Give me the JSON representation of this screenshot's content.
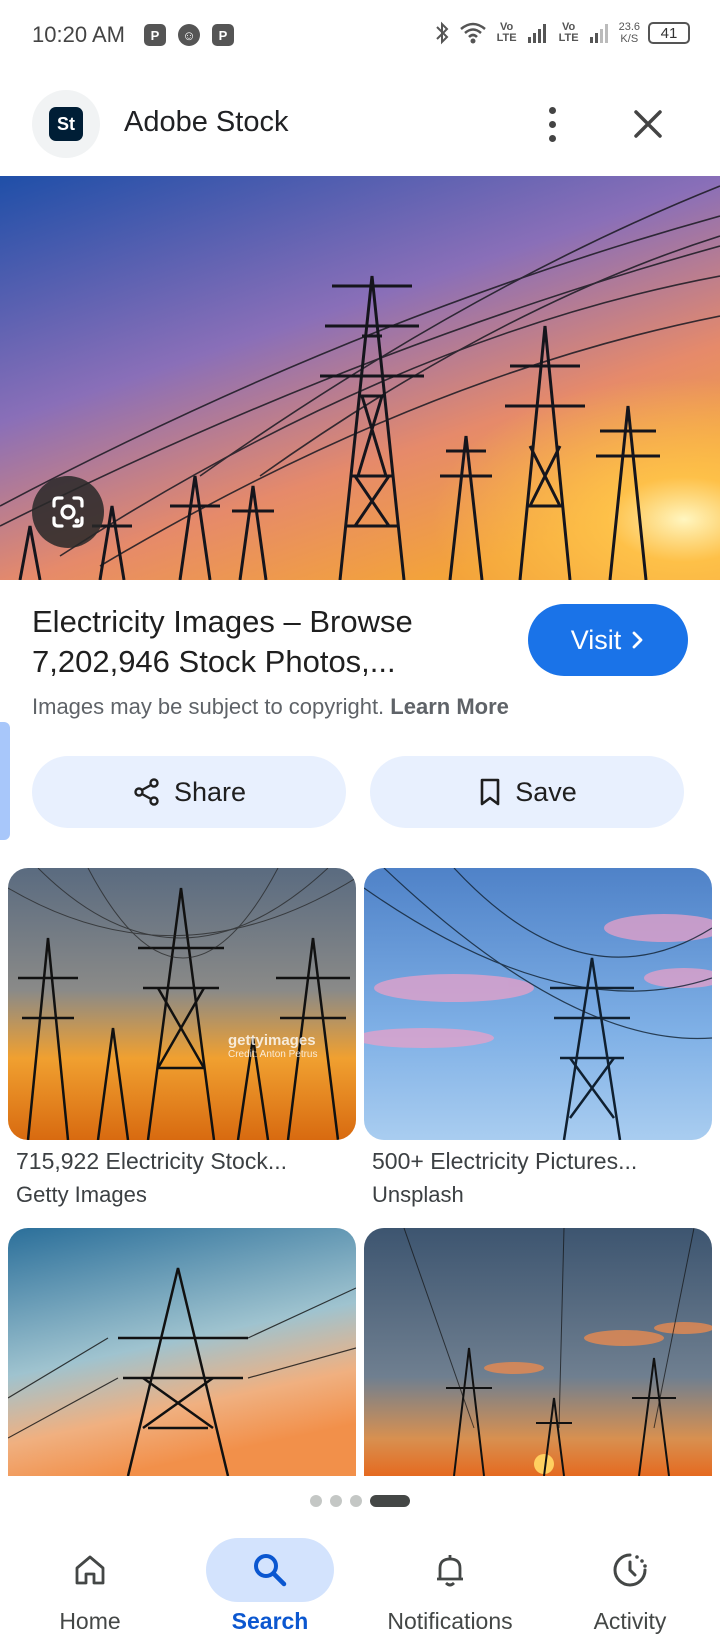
{
  "status_bar": {
    "time": "10:20 AM",
    "vo_lte_1": "Vo LTE",
    "vo_lte_2": "Vo LTE",
    "speed_value": "23.6",
    "speed_unit": "K/S",
    "battery": "41"
  },
  "header": {
    "logo_text": "St",
    "site_name": "Adobe Stock"
  },
  "result": {
    "title": "Electricity Images – Browse 7,202,946 Stock Photos,...",
    "visit_label": "Visit",
    "copyright_text": "Images may be subject to copyright.",
    "learn_more": "Learn More",
    "share_label": "Share",
    "save_label": "Save"
  },
  "related": [
    {
      "caption": "715,922 Electricity Stock...",
      "source": "Getty Images",
      "watermark": "gettyimages",
      "watermark_credit": "Credit: Anton Petrus"
    },
    {
      "caption": "500+ Electricity Pictures...",
      "source": "Unsplash"
    },
    {
      "caption": "",
      "source": ""
    },
    {
      "caption": "",
      "source": ""
    }
  ],
  "pager": {
    "pages": 4,
    "active_index": 3
  },
  "bottom_nav": [
    {
      "label": "Home",
      "icon": "home-icon",
      "active": false
    },
    {
      "label": "Search",
      "icon": "search-icon",
      "active": true
    },
    {
      "label": "Notifications",
      "icon": "bell-icon",
      "active": false
    },
    {
      "label": "Activity",
      "icon": "activity-icon",
      "active": false
    }
  ],
  "colors": {
    "accent": "#1a73e8",
    "chip_bg": "#e8f0fe",
    "nav_active_bg": "#d3e3fd",
    "nav_active_text": "#0b57d0"
  }
}
